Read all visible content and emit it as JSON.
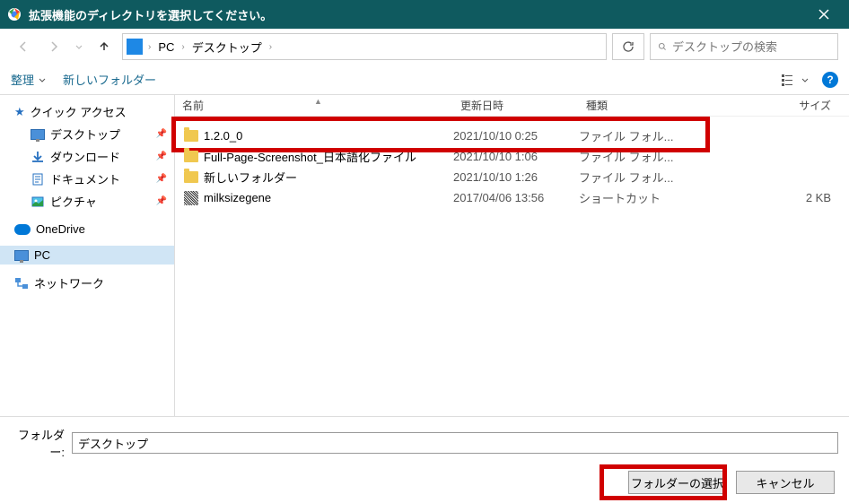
{
  "titlebar": {
    "title": "拡張機能のディレクトリを選択してください。"
  },
  "path": {
    "segments": [
      "PC",
      "デスクトップ"
    ]
  },
  "search": {
    "placeholder": "デスクトップの検索"
  },
  "toolbar": {
    "organize": "整理",
    "new_folder": "新しいフォルダー"
  },
  "sidebar": {
    "quick_access": "クイック アクセス",
    "quick_items": [
      {
        "label": "デスクトップ",
        "icon": "desktop"
      },
      {
        "label": "ダウンロード",
        "icon": "download"
      },
      {
        "label": "ドキュメント",
        "icon": "document"
      },
      {
        "label": "ピクチャ",
        "icon": "pictures"
      }
    ],
    "onedrive": "OneDrive",
    "pc": "PC",
    "network": "ネットワーク"
  },
  "columns": {
    "name": "名前",
    "date": "更新日時",
    "type": "種類",
    "size": "サイズ"
  },
  "files": [
    {
      "name": "1.2.0_0",
      "date": "2021/10/10 0:25",
      "type": "ファイル フォル...",
      "size": "",
      "icon": "folder"
    },
    {
      "name": "Full-Page-Screenshot_日本語化ファイル",
      "date": "2021/10/10 1:06",
      "type": "ファイル フォル...",
      "size": "",
      "icon": "folder"
    },
    {
      "name": "新しいフォルダー",
      "date": "2021/10/10 1:26",
      "type": "ファイル フォル...",
      "size": "",
      "icon": "folder"
    },
    {
      "name": "milksizegene",
      "date": "2017/04/06 13:56",
      "type": "ショートカット",
      "size": "2 KB",
      "icon": "shortcut"
    }
  ],
  "footer": {
    "folder_label": "フォルダー:",
    "folder_value": "デスクトップ",
    "select_button": "フォルダーの選択",
    "cancel_button": "キャンセル"
  }
}
